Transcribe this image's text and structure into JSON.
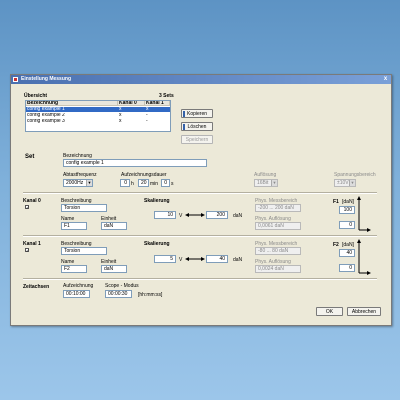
{
  "window": {
    "title": "Einstellung Messung",
    "close_glyph": "x"
  },
  "overview": {
    "title": "Übersicht",
    "sets_count": "3 Sets",
    "columns": [
      "Bezeichnung",
      "Kanal 0",
      "Kanal 1"
    ],
    "rows": [
      {
        "name": "config example 1",
        "k0": "x",
        "k1": "x",
        "selected": true
      },
      {
        "name": "config example 2",
        "k0": "x",
        "k1": "-",
        "selected": false
      },
      {
        "name": "config example 3",
        "k0": "x",
        "k1": "-",
        "selected": false
      }
    ],
    "buttons": {
      "copy": "Kopieren",
      "delete": "Löschen",
      "save": "Speichern"
    }
  },
  "set": {
    "heading": "Set",
    "name_label": "Bezeichnung",
    "name_value": "config example 1",
    "sample_rate_label": "Abtastfrequenz",
    "sample_rate_value": "2000Hz",
    "duration_label": "Aufzeichnungsdauer",
    "duration_h": "0",
    "unit_h": "h",
    "duration_min": "20",
    "unit_min": "min",
    "duration_s": "0",
    "unit_s": "s",
    "resolution_label": "Auflösung",
    "resolution_value": "16Bit",
    "range_label": "Spannungsbereich",
    "range_value": "±10V"
  },
  "channel0": {
    "heading": "Kanal 0",
    "desc_label": "Beschreibung",
    "desc_value": "Torsion",
    "name_label": "Name",
    "name_value": "F1",
    "unit_label": "Einheit",
    "unit_value": "daN",
    "scale_label": "Skalierung",
    "scale_in": "10",
    "scale_in_unit": "V",
    "scale_out": "200",
    "scale_out_unit": "daN",
    "phys_range_label": "Phys. Messbereich",
    "phys_range_value": "-200 ... 200 daN",
    "phys_res_label": "Phys. Auflösung",
    "phys_res_value": "0,0061 daN",
    "axis_label": "F1",
    "axis_unit": "[daN]",
    "axis_max": "100",
    "axis_min": "0"
  },
  "channel1": {
    "heading": "Kanal 1",
    "desc_label": "Beschreibung",
    "desc_value": "Torsion",
    "name_label": "Name",
    "name_value": "F2",
    "unit_label": "Einheit",
    "unit_value": "daN",
    "scale_label": "Skalierung",
    "scale_in": "5",
    "scale_in_unit": "V",
    "scale_out": "40",
    "scale_out_unit": "daN",
    "phys_range_label": "Phys. Messbereich",
    "phys_range_value": "-80 ... 80 daN",
    "phys_res_label": "Phys. Auflösung",
    "phys_res_value": "0,0024 daN",
    "axis_label": "F2",
    "axis_unit": "[daN]",
    "axis_max": "40",
    "axis_min": "0"
  },
  "timing": {
    "heading": "Zeitachsen",
    "rec_label": "Aufzeichnung",
    "rec_value": "00:10:00",
    "scope_label": "Scope - Modus",
    "scope_value": "00:00:30",
    "scope_format": "[hh:mm:ss]"
  },
  "footer": {
    "ok": "OK",
    "cancel": "Abbrechen"
  }
}
